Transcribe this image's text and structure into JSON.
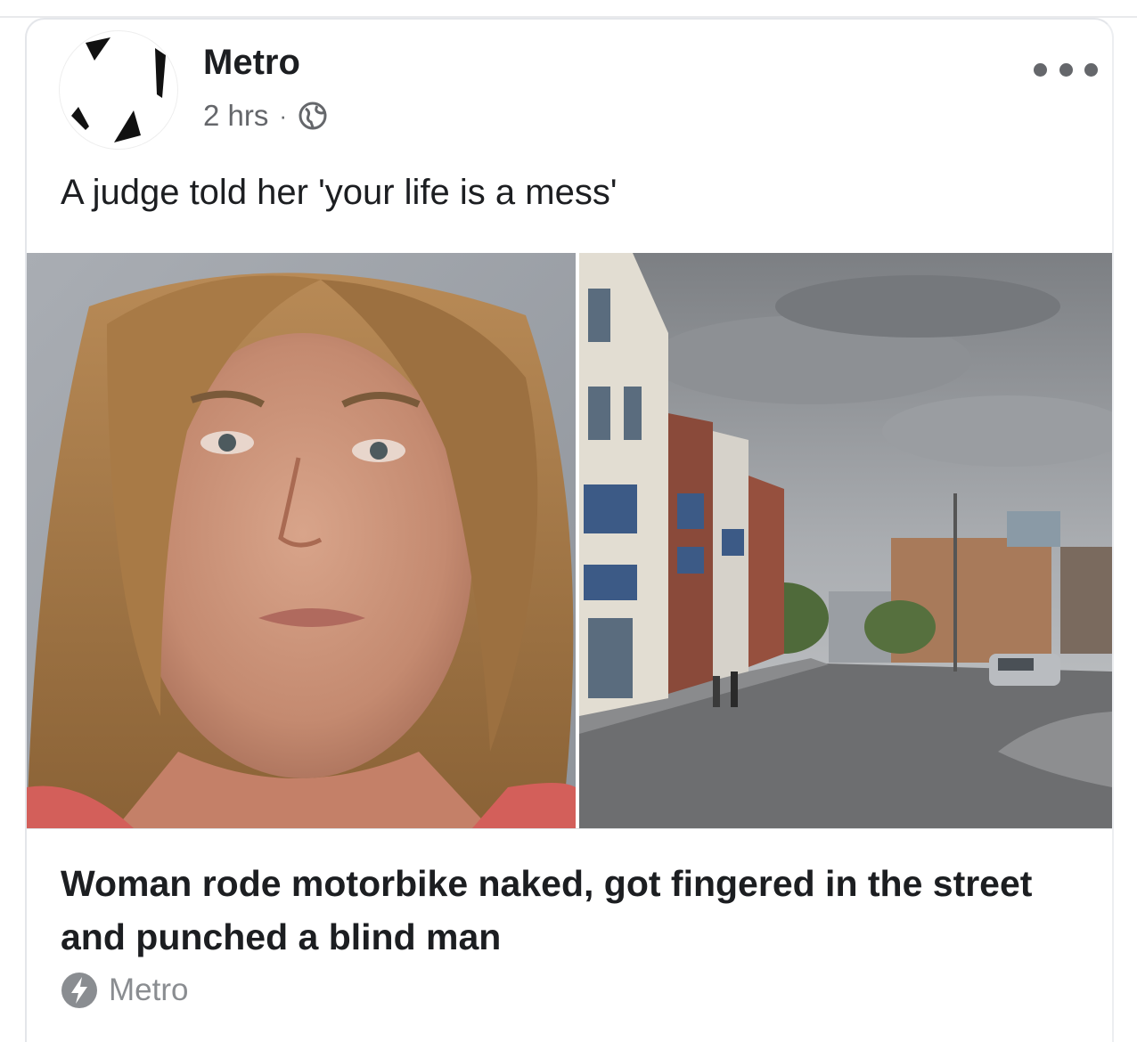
{
  "post": {
    "page_name": "Metro",
    "timestamp": "2 hrs",
    "separator": "·",
    "privacy_icon": "globe-icon",
    "more_icon": "more-options-icon",
    "text": "A judge told her 'your life is a mess'"
  },
  "link_preview": {
    "title": "Woman rode motorbike naked, got fingered in the street and punched a blind man",
    "source_icon": "bolt-icon",
    "source": "Metro"
  },
  "colors": {
    "text_primary": "#1c1e21",
    "text_secondary": "#65676b",
    "divider": "#dddfe2"
  }
}
